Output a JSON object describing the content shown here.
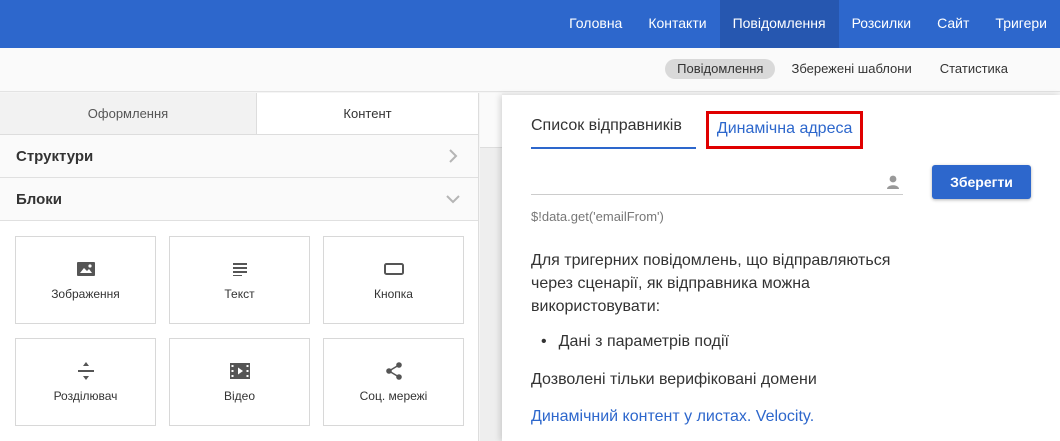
{
  "topnav": {
    "items": [
      {
        "label": "Головна"
      },
      {
        "label": "Контакти"
      },
      {
        "label": "Повідомлення"
      },
      {
        "label": "Розсилки"
      },
      {
        "label": "Сайт"
      },
      {
        "label": "Тригери"
      }
    ],
    "active": "Повідомлення"
  },
  "subnav": {
    "items": [
      {
        "label": "Повідомлення"
      },
      {
        "label": "Збережені шаблони"
      },
      {
        "label": "Статистика"
      }
    ],
    "active": "Повідомлення"
  },
  "editor": {
    "tabs": [
      {
        "label": "Оформлення"
      },
      {
        "label": "Контент"
      }
    ],
    "active_tab": "Контент",
    "sections": {
      "structures": "Структури",
      "blocks": "Блоки"
    },
    "blocks": [
      {
        "label": "Зображення",
        "icon": "image-icon"
      },
      {
        "label": "Текст",
        "icon": "text-icon"
      },
      {
        "label": "Кнопка",
        "icon": "button-icon"
      },
      {
        "label": "Розділювач",
        "icon": "divider-icon"
      },
      {
        "label": "Відео",
        "icon": "video-icon"
      },
      {
        "label": "Соц. мережі",
        "icon": "share-icon"
      }
    ]
  },
  "sender_panel": {
    "tabs": {
      "sender_list": "Список відправників",
      "dynamic_address": "Динамічна адреса"
    },
    "active_tab": "Список відправників",
    "highlighted_tab": "Динамічна адреса",
    "address_input": {
      "value": ""
    },
    "save_label": "Зберегти",
    "hint": "$!data.get('emailFrom')",
    "description": "Для тригерних повідомлень, що відправляються через сценарії, як відправника можна використовувати:",
    "bullet": "Дані з параметрів події",
    "allowed": "Дозволені тільки верифіковані домени",
    "link": "Динамічний контент у листах. Velocity."
  },
  "colors": {
    "primary": "#2d67cc",
    "nav_active": "#2657b0",
    "highlight_border": "#e00000"
  }
}
